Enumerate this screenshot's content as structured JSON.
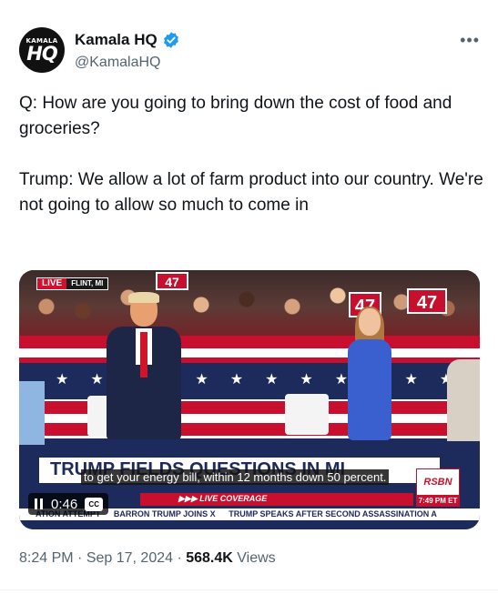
{
  "author": {
    "display_name": "Kamala HQ",
    "handle": "@KamalaHQ",
    "avatar_text_top": "KAMALA",
    "avatar_text_main": "HQ",
    "verified_color": "#1d9bf0"
  },
  "more_menu": "•••",
  "tweet": {
    "paragraphs": [
      "Q: How are you going to bring down the cost of food and groceries?",
      "Trump: We allow a lot of farm product into our country. We're not going to allow so much to come in"
    ]
  },
  "video": {
    "live_label": "LIVE",
    "location": "FLINT, MI",
    "sign_numbers": [
      "47",
      "47",
      "47"
    ],
    "chyron_headline": "TRUMP FIELDS QUESTIONS IN MI",
    "caption": "to get your energy bill, within 12 months down 50 percent.",
    "network": "RSBN",
    "live_coverage": "▶▶▶ LIVE COVERAGE",
    "clock": "7:49 PM ET",
    "ticker_items": [
      "ATION ATTEMPT",
      "BARRON TRUMP JOINS X",
      "TRUMP SPEAKS AFTER SECOND ASSASSINATION A"
    ],
    "player": {
      "time": "0:46",
      "cc_label": "CC"
    }
  },
  "meta": {
    "time": "8:24 PM",
    "separator": " · ",
    "date": "Sep 17, 2024",
    "views_count": "568.4K",
    "views_label": " Views"
  }
}
